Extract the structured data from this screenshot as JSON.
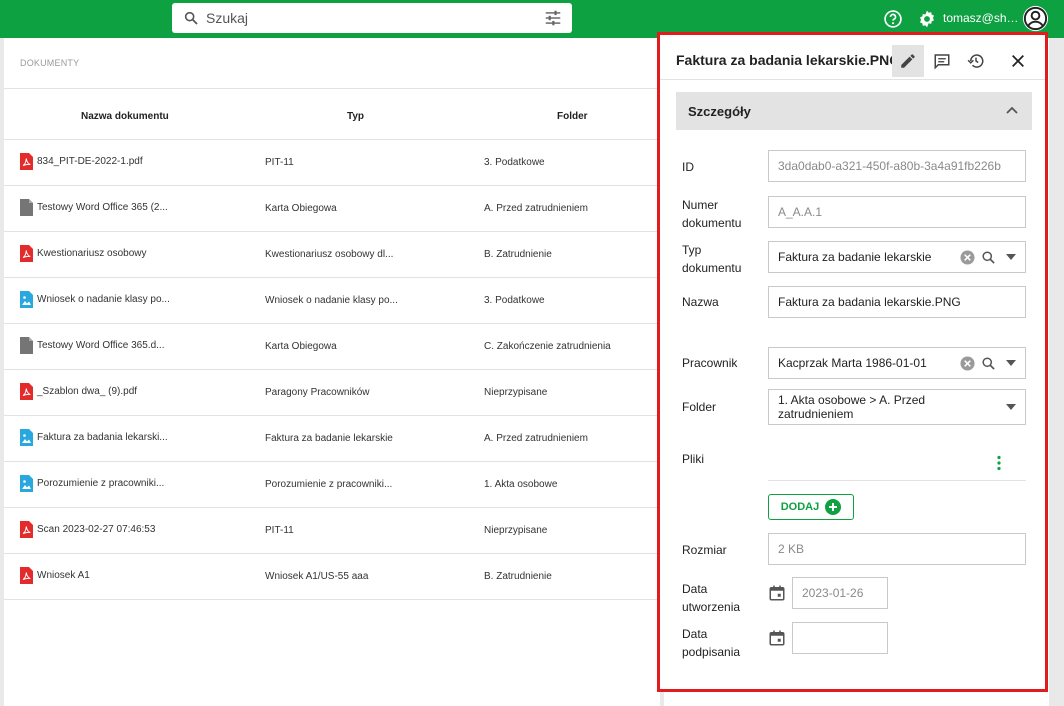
{
  "header": {
    "search_placeholder": "Szukaj",
    "user": "tomasz@sharp.pl",
    "brand_color": "#0ea142"
  },
  "documents": {
    "section_label": "DOKUMENTY",
    "columns": [
      "Nazwa dokumentu",
      "Typ",
      "Folder"
    ],
    "rows": [
      {
        "icon": "pdf-icon",
        "name": "834_PIT-DE-2022-1.pdf",
        "type": "PIT-11",
        "folder": "3. Podatkowe"
      },
      {
        "icon": "document-icon",
        "name": "Testowy Word Office 365 (2...",
        "type": "Karta Obiegowa",
        "folder": "A. Przed zatrudnieniem"
      },
      {
        "icon": "pdf-icon",
        "name": "Kwestionariusz osobowy",
        "type": "Kwestionariusz osobowy dl...",
        "folder": "B. Zatrudnienie"
      },
      {
        "icon": "image-icon",
        "name": "Wniosek o nadanie klasy po...",
        "type": "Wniosek o nadanie klasy po...",
        "folder": "3. Podatkowe"
      },
      {
        "icon": "document-icon",
        "name": "Testowy Word Office 365.d...",
        "type": "Karta Obiegowa",
        "folder": "C. Zakończenie zatrudnienia"
      },
      {
        "icon": "pdf-icon",
        "name": "_Szablon dwa_ (9).pdf",
        "type": "Paragony Pracowników",
        "folder": "Nieprzypisane"
      },
      {
        "icon": "image-icon",
        "name": "Faktura za badania lekarski...",
        "type": "Faktura za badanie lekarskie",
        "folder": "A. Przed zatrudnieniem"
      },
      {
        "icon": "image-icon",
        "name": "Porozumienie z pracowniki...",
        "type": "Porozumienie z pracowniki...",
        "folder": "1. Akta osobowe"
      },
      {
        "icon": "pdf-icon",
        "name": "Scan 2023-02-27 07:46:53",
        "type": "PIT-11",
        "folder": "Nieprzypisane"
      },
      {
        "icon": "pdf-icon",
        "name": "Wniosek A1",
        "type": "Wniosek A1/US-55 aaa",
        "folder": "B. Zatrudnienie"
      }
    ]
  },
  "panel": {
    "title": "Faktura za badania lekarskie.PNG",
    "section_title": "Szczegóły",
    "fields": {
      "id_label": "ID",
      "id_value": "3da0dab0-a321-450f-a80b-3a4a91fb226b",
      "numer_label": "Numer dokumentu",
      "numer_value": "A_A.A.1",
      "typ_label": "Typ dokumentu",
      "typ_value": "Faktura za badanie lekarskie",
      "nazwa_label": "Nazwa",
      "nazwa_value": "Faktura za badania lekarskie.PNG",
      "pracownik_label": "Pracownik",
      "pracownik_value": "Kacprzak Marta 1986-01-01",
      "folder_label": "Folder",
      "folder_value": "1. Akta osobowe > A. Przed zatrudnieniem",
      "pliki_label": "Pliki",
      "add_label": "DODAJ",
      "rozmiar_label": "Rozmiar",
      "rozmiar_value": "2 KB",
      "utworzenia_label": "Data utworzenia",
      "utworzenia_value": "2023-01-26",
      "podpisania_label": "Data podpisania",
      "podpisania_value": ""
    },
    "highlight_color": "#e01c1c"
  }
}
